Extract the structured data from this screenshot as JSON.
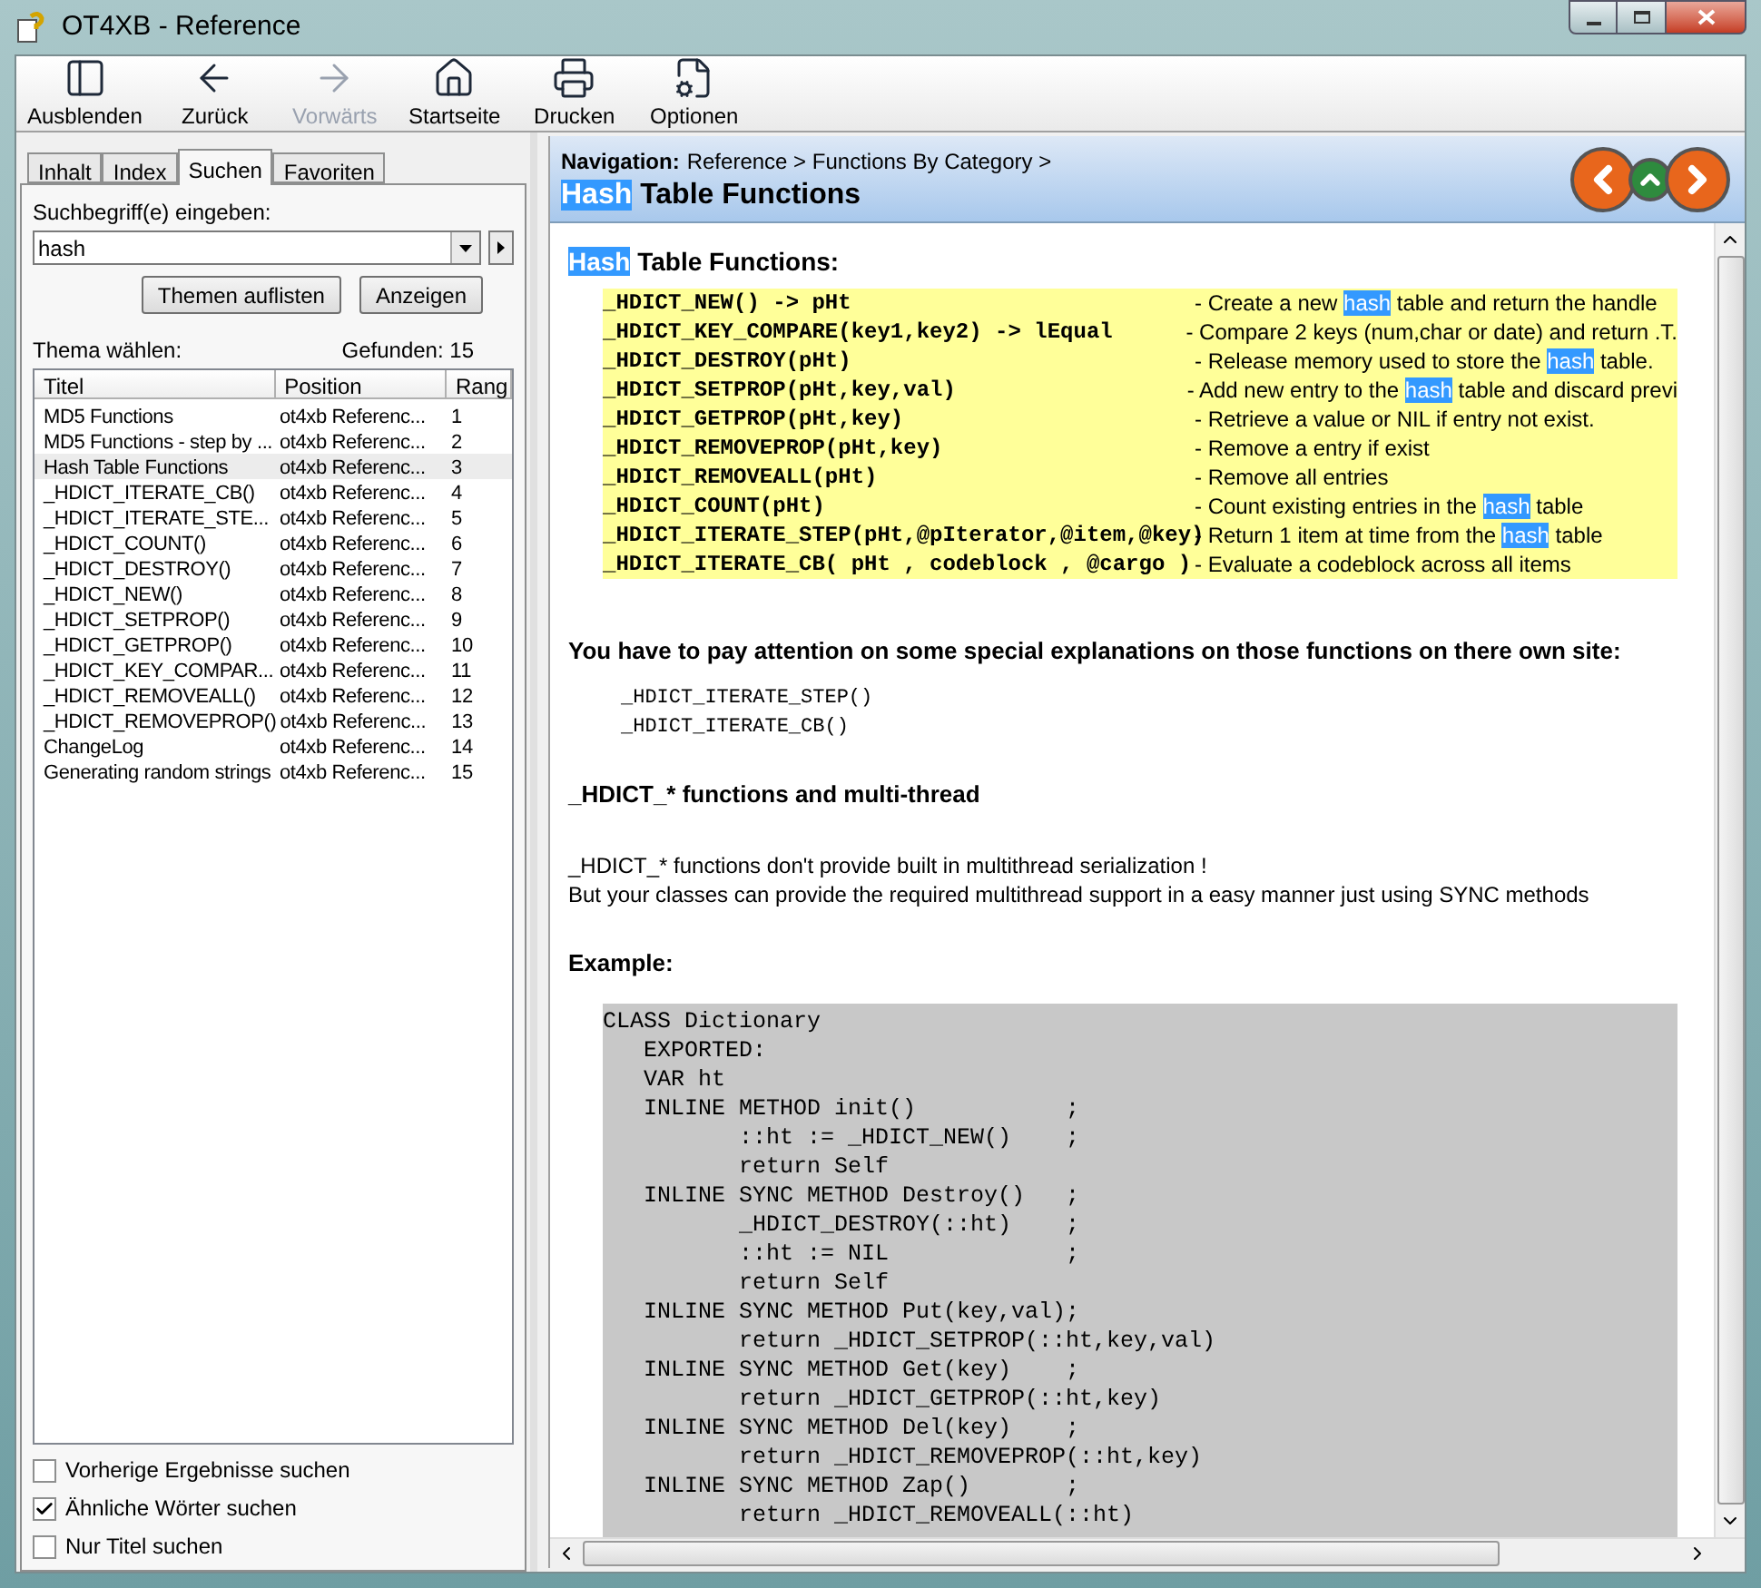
{
  "window": {
    "title": "OT4XB - Reference"
  },
  "toolbar": [
    {
      "label": "Ausblenden",
      "kind": "hide",
      "disabled": false
    },
    {
      "label": "Zurück",
      "kind": "back",
      "disabled": false
    },
    {
      "label": "Vorwärts",
      "kind": "forward",
      "disabled": true
    },
    {
      "label": "Startseite",
      "kind": "home",
      "disabled": false
    },
    {
      "label": "Drucken",
      "kind": "print",
      "disabled": false
    },
    {
      "label": "Optionen",
      "kind": "options",
      "disabled": false
    }
  ],
  "tabs": [
    {
      "label": "Inhalt",
      "selected": false
    },
    {
      "label": "Index",
      "selected": false
    },
    {
      "label": "Suchen",
      "selected": true
    },
    {
      "label": "Favoriten",
      "selected": false
    }
  ],
  "search": {
    "label": "Suchbegriff(e) eingeben:",
    "value": "hash"
  },
  "buttons": [
    "Themen auflisten",
    "Anzeigen"
  ],
  "topic_label": "Thema wählen:",
  "found": "Gefunden: 15",
  "results": {
    "columns": [
      "Titel",
      "Position",
      "Rang"
    ],
    "rows": [
      {
        "cells": [
          "MD5 Functions",
          "ot4xb Referenc...",
          "1"
        ],
        "selected": false
      },
      {
        "cells": [
          "MD5 Functions - step by ...",
          "ot4xb Referenc...",
          "2"
        ],
        "selected": false
      },
      {
        "cells": [
          "Hash Table Functions",
          "ot4xb Referenc...",
          "3"
        ],
        "selected": true
      },
      {
        "cells": [
          "_HDICT_ITERATE_CB()",
          "ot4xb Referenc...",
          "4"
        ],
        "selected": false
      },
      {
        "cells": [
          "_HDICT_ITERATE_STE...",
          "ot4xb Referenc...",
          "5"
        ],
        "selected": false
      },
      {
        "cells": [
          "_HDICT_COUNT()",
          "ot4xb Referenc...",
          "6"
        ],
        "selected": false
      },
      {
        "cells": [
          "_HDICT_DESTROY()",
          "ot4xb Referenc...",
          "7"
        ],
        "selected": false
      },
      {
        "cells": [
          "_HDICT_NEW()",
          "ot4xb Referenc...",
          "8"
        ],
        "selected": false
      },
      {
        "cells": [
          "_HDICT_SETPROP()",
          "ot4xb Referenc...",
          "9"
        ],
        "selected": false
      },
      {
        "cells": [
          "_HDICT_GETPROP()",
          "ot4xb Referenc...",
          "10"
        ],
        "selected": false
      },
      {
        "cells": [
          "_HDICT_KEY_COMPAR...",
          "ot4xb Referenc...",
          "11"
        ],
        "selected": false
      },
      {
        "cells": [
          "_HDICT_REMOVEALL()",
          "ot4xb Referenc...",
          "12"
        ],
        "selected": false
      },
      {
        "cells": [
          "_HDICT_REMOVEPROP()",
          "ot4xb Referenc...",
          "13"
        ],
        "selected": false
      },
      {
        "cells": [
          "ChangeLog",
          "ot4xb Referenc...",
          "14"
        ],
        "selected": false
      },
      {
        "cells": [
          "Generating random strings",
          "ot4xb Referenc...",
          "15"
        ],
        "selected": false
      }
    ]
  },
  "options": [
    {
      "label": "Vorherige Ergebnisse suchen",
      "checked": false
    },
    {
      "label": "Ähnliche Wörter suchen",
      "checked": true
    },
    {
      "label": "Nur Titel suchen",
      "checked": false
    }
  ],
  "document": {
    "navigation_label": "Navigation:",
    "breadcrumb": "Reference > Functions By Category >",
    "title": [
      {
        "text": "Hash",
        "highlighted": true
      },
      {
        "text": " Table Functions",
        "highlighted": false
      }
    ],
    "heading": [
      {
        "text": "Hash",
        "highlighted": true
      },
      {
        "text": " Table Functions:",
        "highlighted": false
      }
    ],
    "functions": [
      {
        "signature": "_HDICT_NEW() -> pHt",
        "description": [
          {
            "text": "- Create a new ",
            "highlighted": false
          },
          {
            "text": "hash",
            "highlighted": true
          },
          {
            "text": " table and return the handle",
            "highlighted": false
          }
        ]
      },
      {
        "signature": "_HDICT_KEY_COMPARE(key1,key2) -> lEqual",
        "description": [
          {
            "text": "- Compare 2 keys (num,char or date) and return .T.",
            "highlighted": false
          }
        ]
      },
      {
        "signature": "_HDICT_DESTROY(pHt)",
        "description": [
          {
            "text": "- Release memory used to store the ",
            "highlighted": false
          },
          {
            "text": "hash",
            "highlighted": true
          },
          {
            "text": " table.",
            "highlighted": false
          }
        ]
      },
      {
        "signature": "_HDICT_SETPROP(pHt,key,val)",
        "description": [
          {
            "text": "- Add new entry to the ",
            "highlighted": false
          },
          {
            "text": "hash",
            "highlighted": true
          },
          {
            "text": " table and discard previ",
            "highlighted": false
          }
        ]
      },
      {
        "signature": "_HDICT_GETPROP(pHt,key)",
        "description": [
          {
            "text": "- Retrieve a value or NIL if entry not exist.",
            "highlighted": false
          }
        ]
      },
      {
        "signature": "_HDICT_REMOVEPROP(pHt,key)",
        "description": [
          {
            "text": "- Remove a entry if exist",
            "highlighted": false
          }
        ]
      },
      {
        "signature": "_HDICT_REMOVEALL(pHt)",
        "description": [
          {
            "text": "- Remove all entries",
            "highlighted": false
          }
        ]
      },
      {
        "signature": "_HDICT_COUNT(pHt)",
        "description": [
          {
            "text": "- Count existing entries in the ",
            "highlighted": false
          },
          {
            "text": "hash",
            "highlighted": true
          },
          {
            "text": " table",
            "highlighted": false
          }
        ]
      },
      {
        "signature": "_HDICT_ITERATE_STEP(pHt,@pIterator,@item,@key)",
        "description": [
          {
            "text": "- Return 1 item at time from the ",
            "highlighted": false
          },
          {
            "text": "hash",
            "highlighted": true
          },
          {
            "text": " table",
            "highlighted": false
          }
        ]
      },
      {
        "signature": "_HDICT_ITERATE_CB( pHt , codeblock , @cargo )",
        "description": [
          {
            "text": "- Evaluate a codeblock across all items",
            "highlighted": false
          }
        ]
      }
    ],
    "attention": "You have to pay attention on some special explanations on those functions on there own site:",
    "special_functions": [
      "_HDICT_ITERATE_STEP()",
      "_HDICT_ITERATE_CB()"
    ],
    "section_heading": "_HDICT_* functions and multi-thread",
    "paragraph_lines": [
      "_HDICT_* functions don't provide built in multithread serialization !",
      "But your classes can provide the required multithread support in a easy manner just using SYNC methods"
    ],
    "example_heading": "Example:",
    "code": [
      "CLASS Dictionary",
      "   EXPORTED:",
      "   VAR ht",
      "   INLINE METHOD init()           ;",
      "          ::ht := _HDICT_NEW()    ;",
      "          return Self",
      "   INLINE SYNC METHOD Destroy()   ;",
      "          _HDICT_DESTROY(::ht)    ;",
      "          ::ht := NIL             ;",
      "          return Self",
      "   INLINE SYNC METHOD Put(key,val);",
      "          return _HDICT_SETPROP(::ht,key,val)",
      "   INLINE SYNC METHOD Get(key)    ;",
      "          return _HDICT_GETPROP(::ht,key)",
      "   INLINE SYNC METHOD Del(key)    ;",
      "          return _HDICT_REMOVEPROP(::ht,key)",
      "   INLINE SYNC METHOD Zap()       ;",
      "          return _HDICT_REMOVEALL(::ht)"
    ]
  }
}
